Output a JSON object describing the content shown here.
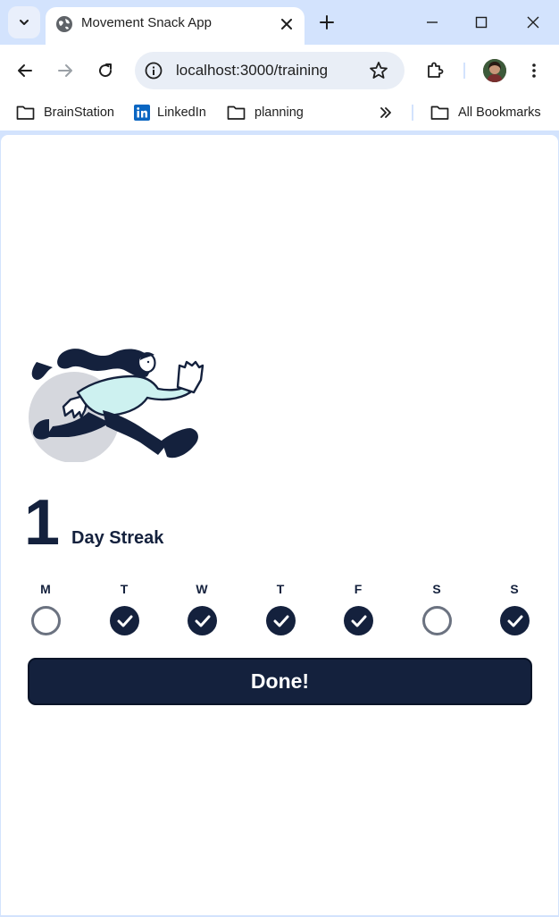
{
  "browser": {
    "tab": {
      "title": "Movement Snack App"
    },
    "address_bar": {
      "url": "localhost:3000/training"
    },
    "bookmarks": [
      {
        "label": "BrainStation",
        "icon": "folder-icon"
      },
      {
        "label": "LinkedIn",
        "icon": "linkedin-icon"
      },
      {
        "label": "planning",
        "icon": "folder-icon"
      }
    ],
    "all_bookmarks_label": "All Bookmarks"
  },
  "streak": {
    "count": "1",
    "label": "Day Streak"
  },
  "week": [
    {
      "letter": "M",
      "completed": false
    },
    {
      "letter": "T",
      "completed": true
    },
    {
      "letter": "W",
      "completed": true
    },
    {
      "letter": "T",
      "completed": true
    },
    {
      "letter": "F",
      "completed": true
    },
    {
      "letter": "S",
      "completed": false
    },
    {
      "letter": "S",
      "completed": true
    }
  ],
  "done_button": {
    "label": "Done!"
  },
  "colors": {
    "primary": "#14213d",
    "accent_shirt": "#cdf1f0",
    "sun_circle": "#d5d7dd",
    "unchecked_ring": "#6b7280"
  }
}
